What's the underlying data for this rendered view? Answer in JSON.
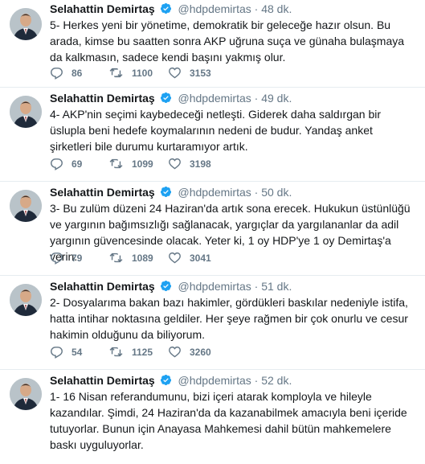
{
  "tweets": [
    {
      "name": "Selahattin Demirtaş",
      "handle": "@hdpdemirtas",
      "separator": "·",
      "time": "48 dk.",
      "text": "5- Herkes yeni bir yönetime, demokratik bir geleceğe hazır olsun. Bu arada, kimse bu saatten sonra AKP uğruna suça ve günaha bulaşmaya da kalkmasın, sadece kendi başını yakmış olur.",
      "replies": "86",
      "retweets": "1100",
      "likes": "3153"
    },
    {
      "name": "Selahattin Demirtaş",
      "handle": "@hdpdemirtas",
      "separator": "·",
      "time": "49 dk.",
      "text": "4- AKP'nin seçimi kaybedeceği netleşti. Giderek daha saldırgan bir üslupla beni hedefe koymalarının nedeni de budur. Yandaş anket şirketleri bile durumu kurtaramıyor artık.",
      "replies": "69",
      "retweets": "1099",
      "likes": "3198"
    },
    {
      "name": "Selahattin Demirtaş",
      "handle": "@hdpdemirtas",
      "separator": "·",
      "time": "50 dk.",
      "text": "3- Bu zulüm düzeni 24 Haziran'da artık sona erecek. Hukukun üstünlüğü ve yargının bağımsızlığı sağlanacak, yargıçlar da yargılananlar da adil yargının güvencesinde olacak. Yeter ki, 1 oy HDP'ye 1 oy Demirtaş'a verin.",
      "replies": "79",
      "retweets": "1089",
      "likes": "3041"
    },
    {
      "name": "Selahattin Demirtaş",
      "handle": "@hdpdemirtas",
      "separator": "·",
      "time": "51 dk.",
      "text": "2- Dosyalarıma bakan bazı hakimler, gördükleri baskılar nedeniyle istifa, hatta intihar noktasına geldiler. Her şeye rağmen bir çok onurlu ve cesur hakimin olduğunu da biliyorum.",
      "replies": "54",
      "retweets": "1125",
      "likes": "3260"
    },
    {
      "name": "Selahattin Demirtaş",
      "handle": "@hdpdemirtas",
      "separator": "·",
      "time": "52 dk.",
      "text": "1- 16 Nisan referandumunu, bizi içeri atarak komployla ve hileyle kazandılar. Şimdi, 24 Haziran'da da kazanabilmek amacıyla beni içeride tutuyorlar. Bunun için Anayasa Mahkemesi dahil bütün mahkemelere baskı uyguluyorlar.",
      "replies": "",
      "retweets": "",
      "likes": ""
    }
  ],
  "colors": {
    "text": "#14171a",
    "muted": "#657786",
    "verified": "#1da1f2",
    "divider": "#e6ecf0"
  },
  "icons": [
    "reply-icon",
    "retweet-icon",
    "like-icon",
    "verified-badge-icon"
  ]
}
